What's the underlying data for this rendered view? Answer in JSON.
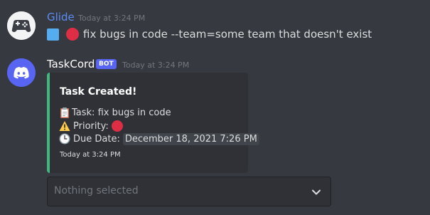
{
  "messages": [
    {
      "username": "Glide",
      "timestamp": "Today at 3:24 PM",
      "avatar_icon": "controller-icon",
      "content": "fix bugs in code --team=some team that doesn't exist",
      "content_emojis": [
        "blue-square-icon",
        "red-circle-icon"
      ]
    },
    {
      "username": "TaskCord",
      "bot_tag": "BOT",
      "timestamp": "Today at 3:24 PM",
      "avatar_icon": "discord-logo-icon",
      "embed": {
        "accent_color": "#43b581",
        "title": "Task Created!",
        "task_line": "Task: fix bugs in code",
        "priority_label": "Priority:",
        "due_label": "Due Date:",
        "due_value": "December 18, 2021 7:26 PM",
        "footer": "Today at 3:24 PM"
      },
      "select_menu": {
        "placeholder": "Nothing selected",
        "selected_value": ""
      }
    }
  ],
  "colors": {
    "background": "#36393f",
    "glide_name": "#5c8cf2",
    "blurple": "#5865f2",
    "embed_bg": "#2f3136",
    "priority_red": "#dd2e44"
  }
}
